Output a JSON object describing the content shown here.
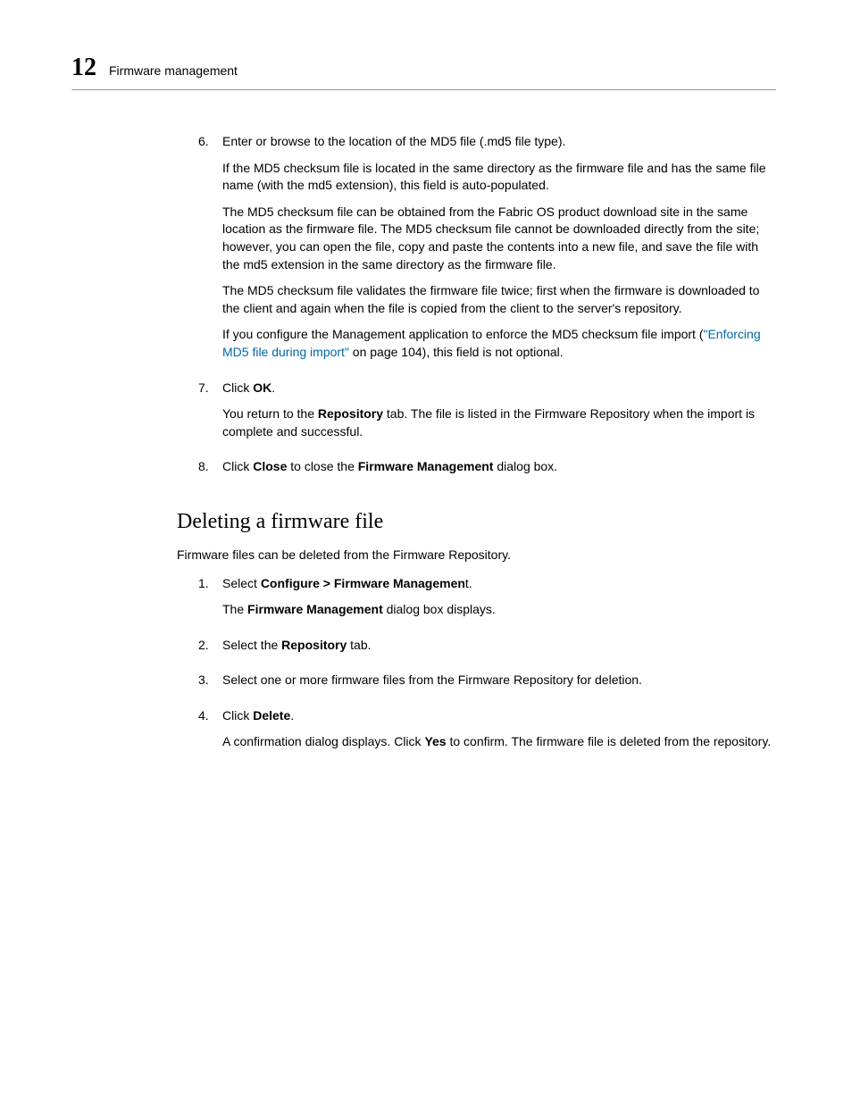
{
  "header": {
    "pageNumber": "12",
    "title": "Firmware management"
  },
  "section1": {
    "item6": {
      "num": "6.",
      "main": "Enter or browse to the location of the MD5 file (.md5 file type).",
      "p1": "If the MD5 checksum file is located in the same directory as the firmware file and has the same file name (with the md5 extension), this field is auto-populated.",
      "p2": "The MD5 checksum file can be obtained from the Fabric OS product download site in the same location as the firmware file. The MD5 checksum file cannot be downloaded directly from the site; however, you can open the file, copy and paste the contents into a new file, and save the file with the md5 extension in the same directory as the firmware file.",
      "p3": "The MD5 checksum file validates the firmware file twice; first when the firmware is downloaded to the client and again when the file is copied from the client to the server's repository.",
      "p4a": "If you configure the Management application to enforce the MD5 checksum file import (",
      "p4link": "\"Enforcing MD5 file during import\"",
      "p4b": " on page 104), this field is not optional."
    },
    "item7": {
      "num": "7.",
      "main_a": "Click ",
      "main_b": "OK",
      "main_c": ".",
      "p1a": "You return to the ",
      "p1b": "Repository",
      "p1c": " tab. The file is listed in the Firmware Repository when the import is complete and successful."
    },
    "item8": {
      "num": "8.",
      "a": "Click ",
      "b": "Close",
      "c": " to close the ",
      "d": "Firmware Management",
      "e": " dialog box."
    }
  },
  "section2": {
    "heading": "Deleting a firmware file",
    "intro": "Firmware files can be deleted from the Firmware Repository.",
    "item1": {
      "num": "1.",
      "a": "Select ",
      "b": "Configure > Firmware Managemen",
      "c": "t.",
      "p1a": "The ",
      "p1b": "Firmware Management",
      "p1c": " dialog box displays."
    },
    "item2": {
      "num": "2.",
      "a": "Select the ",
      "b": "Repository",
      "c": " tab."
    },
    "item3": {
      "num": "3.",
      "text": "Select one or more firmware files from the Firmware Repository for deletion."
    },
    "item4": {
      "num": "4.",
      "a": "Click ",
      "b": "Delete",
      "c": ".",
      "p1a": "A confirmation dialog displays. Click ",
      "p1b": "Yes",
      "p1c": " to confirm. The firmware file is deleted from the repository."
    }
  }
}
